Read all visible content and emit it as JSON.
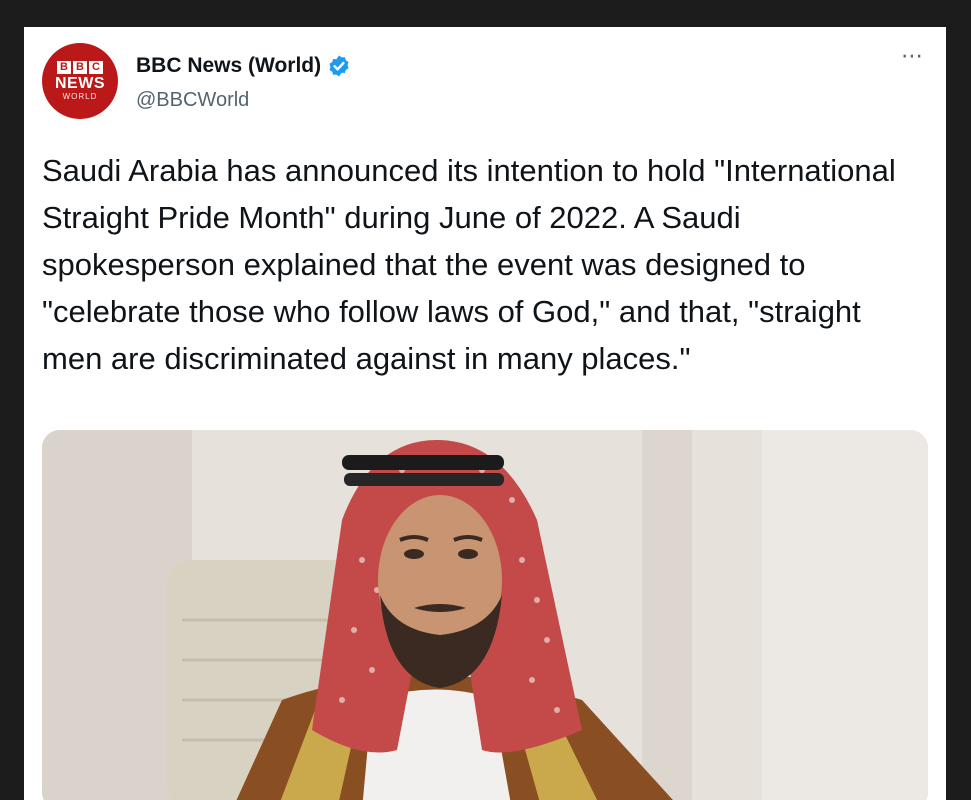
{
  "tweet": {
    "avatar": {
      "brand_blocks": [
        "B",
        "B",
        "C"
      ],
      "brand_word": "NEWS",
      "brand_sub": "WORLD",
      "color": "#bb1919"
    },
    "display_name": "BBC News (World)",
    "verified": true,
    "handle": "@BBCWorld",
    "more_icon": "⋯",
    "text": "Saudi Arabia has announced its intention to hold \"International Straight Pride Month\" during June of 2022. A Saudi spokesperson explained that the event was designed to \"celebrate those who follow laws of God,\" and that, \"straight men are discriminated against in many places.\"",
    "media": {
      "type": "photo"
    }
  },
  "colors": {
    "page_background": "#1c1c1c",
    "card_background": "#ffffff",
    "verified_badge": "#1d9bf0",
    "secondary_text": "#536471",
    "primary_text": "#0f1419"
  }
}
